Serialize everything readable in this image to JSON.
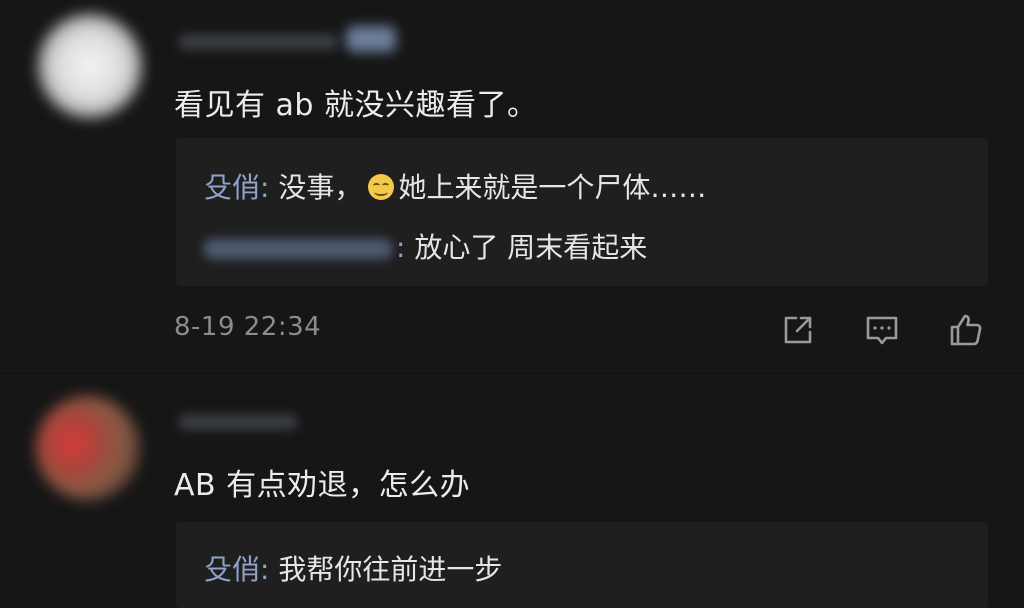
{
  "comments": [
    {
      "text": "看见有 ab 就没兴趣看了。",
      "replies": [
        {
          "author": "殳俏",
          "separator": ":",
          "text_before_emoji": "没事，",
          "emoji": "grinning-face-emoji",
          "text_after_emoji": "她上来就是一个尸体……"
        },
        {
          "separator": ":",
          "text": "放心了  周末看起来"
        }
      ],
      "timestamp": "8-19 22:34",
      "actions": [
        "share-icon",
        "comment-icon",
        "like-icon"
      ]
    },
    {
      "text": "AB 有点劝退，怎么办",
      "replies": [
        {
          "author": "殳俏",
          "separator": ":",
          "text": "我帮你往前进一步"
        }
      ]
    }
  ],
  "colors": {
    "background": "#161616",
    "reply_background": "#1f1f1f",
    "author_link": "#8fa3c9",
    "text_primary": "#ececec",
    "text_secondary": "#8c8c8c"
  }
}
